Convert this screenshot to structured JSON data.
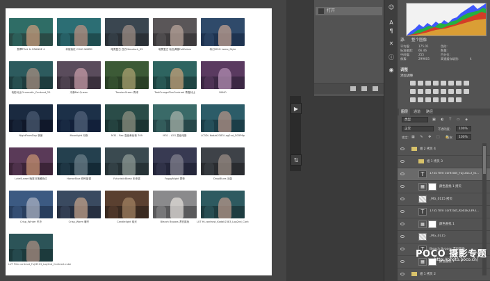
{
  "canvas": {
    "thumbnails": [
      {
        "caption": "翡翠TEAL & ORANGE 4",
        "sky": "#2f6d66",
        "fig": "#c79a7b",
        "fig2": "#2a4b46"
      },
      {
        "caption": "你被我红 COLD WARM",
        "sky": "#2c6e74",
        "fig": "#b88f80",
        "fig2": "#1f4d50"
      },
      {
        "caption": "暗黑复古 西方Nimotsch_55",
        "sky": "#3a4650",
        "fig": "#9e8e86",
        "fig2": "#2a3036"
      },
      {
        "caption": "暗黑复古 秋色调暖FallColors",
        "sky": "#5a5658",
        "fig": "#b8a49a",
        "fig2": "#3d3a3c"
      },
      {
        "caption": "科幻MOO Lomo_Style",
        "sky": "#2f4a6a",
        "fig": "#c0a090",
        "fig2": "#1e3350"
      },
      {
        "caption": "电影对比Cinematic_Contrast_25",
        "sky": "#2d5b5e",
        "fig": "#a48c80",
        "fig2": "#1e3c3e"
      },
      {
        "caption": "冷静Rai Queen",
        "sky": "#5a4c5c",
        "fig": "#c49aa6",
        "fig2": "#3a303c"
      },
      {
        "caption": "TensionGreen 青绿",
        "sky": "#3c5a36",
        "fig": "#a8a070",
        "fig2": "#2a4026"
      },
      {
        "caption": "TealOrangePlusContrast 青橙对比",
        "sky": "#2e6460",
        "fig": "#c4a07a",
        "fig2": "#1e4442"
      },
      {
        "caption": "RANO",
        "sky": "#5a3a60",
        "fig": "#b08cb0",
        "fig2": "#3c2844"
      },
      {
        "caption": "NightFromDay 夜景",
        "sky": "#1a2a40",
        "fig": "#4a5a70",
        "fig2": "#10182a"
      },
      {
        "caption": "Moonlight 月夜",
        "sky": "#1c3048",
        "fig": "#52627a",
        "fig2": "#12203a"
      },
      {
        "caption": "M31 - Rec 高级黄色夜 709",
        "sky": "#2a4c48",
        "fig": "#8c8f80",
        "fig2": "#1c3432"
      },
      {
        "caption": "M31 - LOG 高级电影",
        "sky": "#3a6a68",
        "fig": "#a4b0a8",
        "fig2": "#28484a"
      },
      {
        "caption": "LC3DL Kodak2383 Log2nd_D35P6p",
        "sky": "#2c5c68",
        "fig": "#b29286",
        "fig2": "#1c3e48"
      },
      {
        "caption": "LateSunset 晚夏日落暖色红",
        "sky": "#5a3a58",
        "fig": "#c49070",
        "fig2": "#3c2438"
      },
      {
        "caption": "HorrorBlue 恐怖蓝调",
        "sky": "#24404e",
        "fig": "#6a7e88",
        "fig2": "#142a36"
      },
      {
        "caption": "FuturisticBleak 未来感",
        "sky": "#3a4a50",
        "fig": "#8e9a94",
        "fig2": "#263236"
      },
      {
        "caption": "FoggyNight 雾夜",
        "sky": "#383a52",
        "fig": "#80808e",
        "fig2": "#24263a"
      },
      {
        "caption": "DropBlues 淡蓝",
        "sky": "#3e4248",
        "fig": "#9a8c84",
        "fig2": "#2a2c30"
      },
      {
        "caption": "Crisp_Winter 冬冷",
        "sky": "#3c5a82",
        "fig": "#a8b0c0",
        "fig2": "#283e5e"
      },
      {
        "caption": "Crisp_Warm 暖冬",
        "sky": "#3a4a60",
        "fig": "#c0a088",
        "fig2": "#262f40"
      },
      {
        "caption": "Candlelight 烛光",
        "sky": "#5a4030",
        "fig": "#a08060",
        "fig2": "#3a2a20"
      },
      {
        "caption": "Bleach Bypass 漂白跳色",
        "sky": "#8a8a8c",
        "fig": "#e0dcd8",
        "fig2": "#5a5a5c"
      },
      {
        "caption": "LUT Hi-contrast_Kodak2383_Log2nd_Contrast",
        "sky": "#2e5a60",
        "fig": "#b69688",
        "fig2": "#1e3c40"
      },
      {
        "caption": "",
        "sky": "#2c5458",
        "fig": "#a88c80",
        "fig2": "#1c3a3c"
      }
    ],
    "bottom_caption": "LUT Film contrast_Fuji3513_Log2nd_Contrast.cube"
  },
  "mini_strip": {
    "play_icon": "▶",
    "adjust_icon": "⇅"
  },
  "history": {
    "open_label": "打开"
  },
  "histogram": {
    "channel_label": "通道:",
    "source_label": "源:",
    "source_value": "整个图像",
    "stats_left": [
      {
        "k": "平均值:",
        "v": "175.01"
      },
      {
        "k": "标准偏差:",
        "v": "66.46"
      },
      {
        "k": "中间值:",
        "v": "255"
      },
      {
        "k": "像素:",
        "v": "299605"
      }
    ],
    "stats_right": [
      {
        "k": "色阶:",
        "v": ""
      },
      {
        "k": "数量:",
        "v": ""
      },
      {
        "k": "百分位:",
        "v": ""
      },
      {
        "k": "高速缓存级别:",
        "v": "4"
      }
    ]
  },
  "adjustments": {
    "title": "调整",
    "subtitle": "添加调整"
  },
  "layers_panel": {
    "tabs": [
      "图层",
      "通道",
      "路径"
    ],
    "filter_label": "类型",
    "blend_mode": "正常",
    "opacity_label": "不透明度:",
    "opacity_value": "100%",
    "lock_label": "锁定:",
    "fill_label": "填充:",
    "fill_value": "100%",
    "layers": [
      {
        "name": "组 2 拷贝 4",
        "kind": "group",
        "indent": 16
      },
      {
        "name": "组 1 拷贝 3",
        "kind": "group",
        "indent": 26
      },
      {
        "name": "17x5 film contrast_Fuji3513_lo...",
        "kind": "text",
        "indent": 30,
        "selected": true
      },
      {
        "name": "颜色查找 1 拷贝",
        "kind": "adjust",
        "indent": 30
      },
      {
        "name": "_MG_0115 拷贝",
        "kind": "image",
        "indent": 30
      },
      {
        "name": "17x5 film contrast_Kodak2393...",
        "kind": "text",
        "indent": 30
      },
      {
        "name": "颜色查找 1",
        "kind": "adjust",
        "indent": 30
      },
      {
        "name": "_MG_0115",
        "kind": "image",
        "indent": 30
      },
      {
        "name": "Bleach Bypass 漂白跳色",
        "kind": "text",
        "indent": 30
      },
      {
        "name": "颜色查找 1",
        "kind": "adjust",
        "indent": 30
      },
      {
        "name": "组 1 拷贝 2",
        "kind": "group",
        "indent": 16
      }
    ]
  },
  "watermark": {
    "brand": "POCO 摄影专题",
    "url": "http://photo.poco.cn/"
  }
}
